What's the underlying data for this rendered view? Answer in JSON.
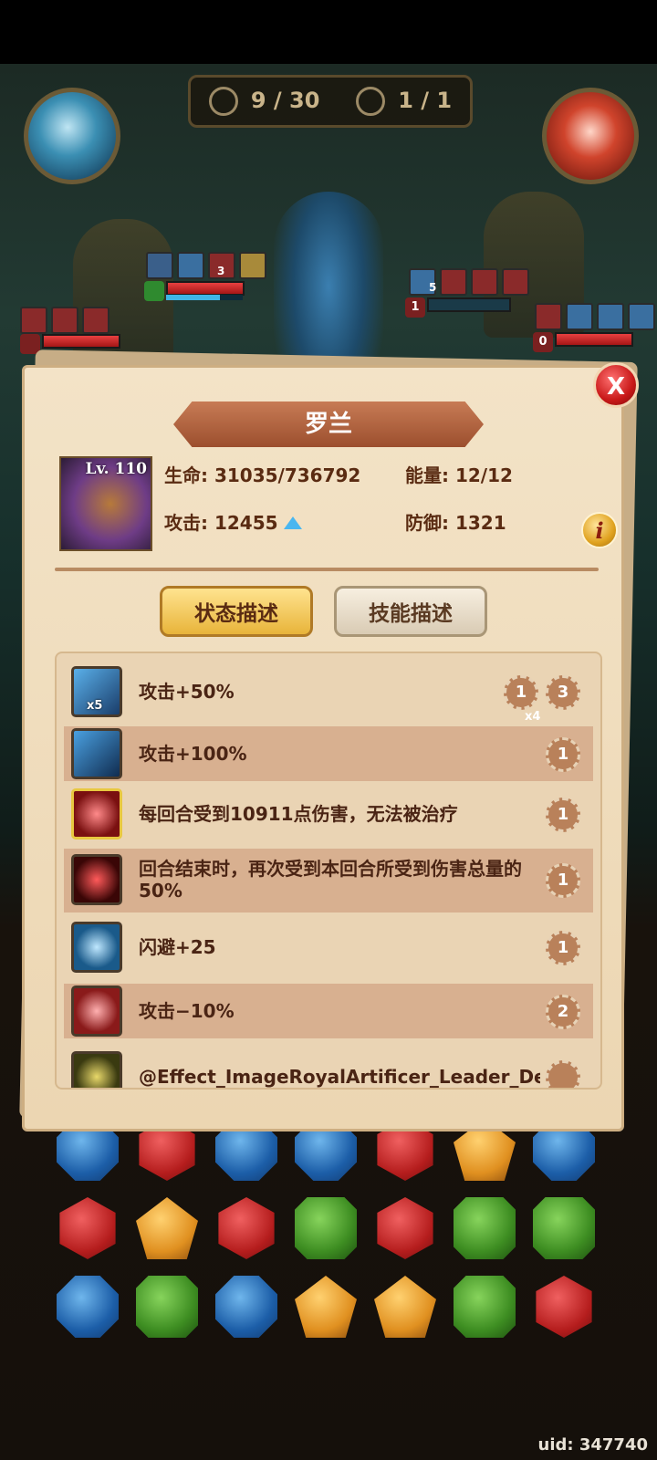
{
  "hud": {
    "turn_counter": "9 / 30",
    "attack_counter": "1 / 1",
    "left_orb_icon": "water-wave-icon",
    "right_orb_icon": "fire-crest-icon"
  },
  "enemy_tags": {
    "a_stack": "3",
    "b_stack": "5",
    "b_level": "1",
    "c_level": "0"
  },
  "panel": {
    "title": "罗兰",
    "close_label": "X",
    "level": "Lv. 110",
    "hp": "生命: 31035/736792",
    "energy": "能量: 12/12",
    "attack": "攻击: 12455",
    "defense": "防御: 1321",
    "info_label": "i",
    "tabs": [
      "状态描述",
      "技能描述"
    ]
  },
  "effects": [
    {
      "icon": "blade-up-icon",
      "text": "攻击+50%",
      "stack": "x5",
      "durations": [
        "1",
        "3"
      ],
      "sub": "x4"
    },
    {
      "icon": "sword-icon",
      "text": "攻击+100%",
      "durations": [
        "1"
      ]
    },
    {
      "icon": "coral-bleed-icon",
      "text": "每回合受到10911点伤害，无法被治疗",
      "durations": [
        "1"
      ]
    },
    {
      "icon": "cursed-bow-icon",
      "text": "回合结束时，再次受到本回合所受到伤害总量的50%",
      "durations": [
        "1"
      ]
    },
    {
      "icon": "dodge-cloud-icon",
      "text": "闪避+25",
      "durations": [
        "1"
      ]
    },
    {
      "icon": "broken-axe-icon",
      "text": "攻击−10%",
      "durations": [
        "2"
      ]
    },
    {
      "icon": "royal-artificer-icon",
      "text": "@Effect_ImageRoyalArtificer_Leader_De",
      "durations": [
        ""
      ]
    }
  ],
  "board": [
    [
      "blue",
      "red",
      "blue",
      "blue",
      "red",
      "yellow",
      "blue"
    ],
    [
      "red",
      "yellow",
      "red",
      "green",
      "red",
      "green",
      "green"
    ],
    [
      "blue",
      "green",
      "blue",
      "yellow",
      "yellow",
      "green",
      "red"
    ]
  ],
  "footer": {
    "uid": "uid: 347740"
  },
  "colors": {
    "panel_bg": "#f3e3c7",
    "title_banner": "#b0643f",
    "tab_active": "#f2c653",
    "text_brown": "#5a2b12"
  }
}
